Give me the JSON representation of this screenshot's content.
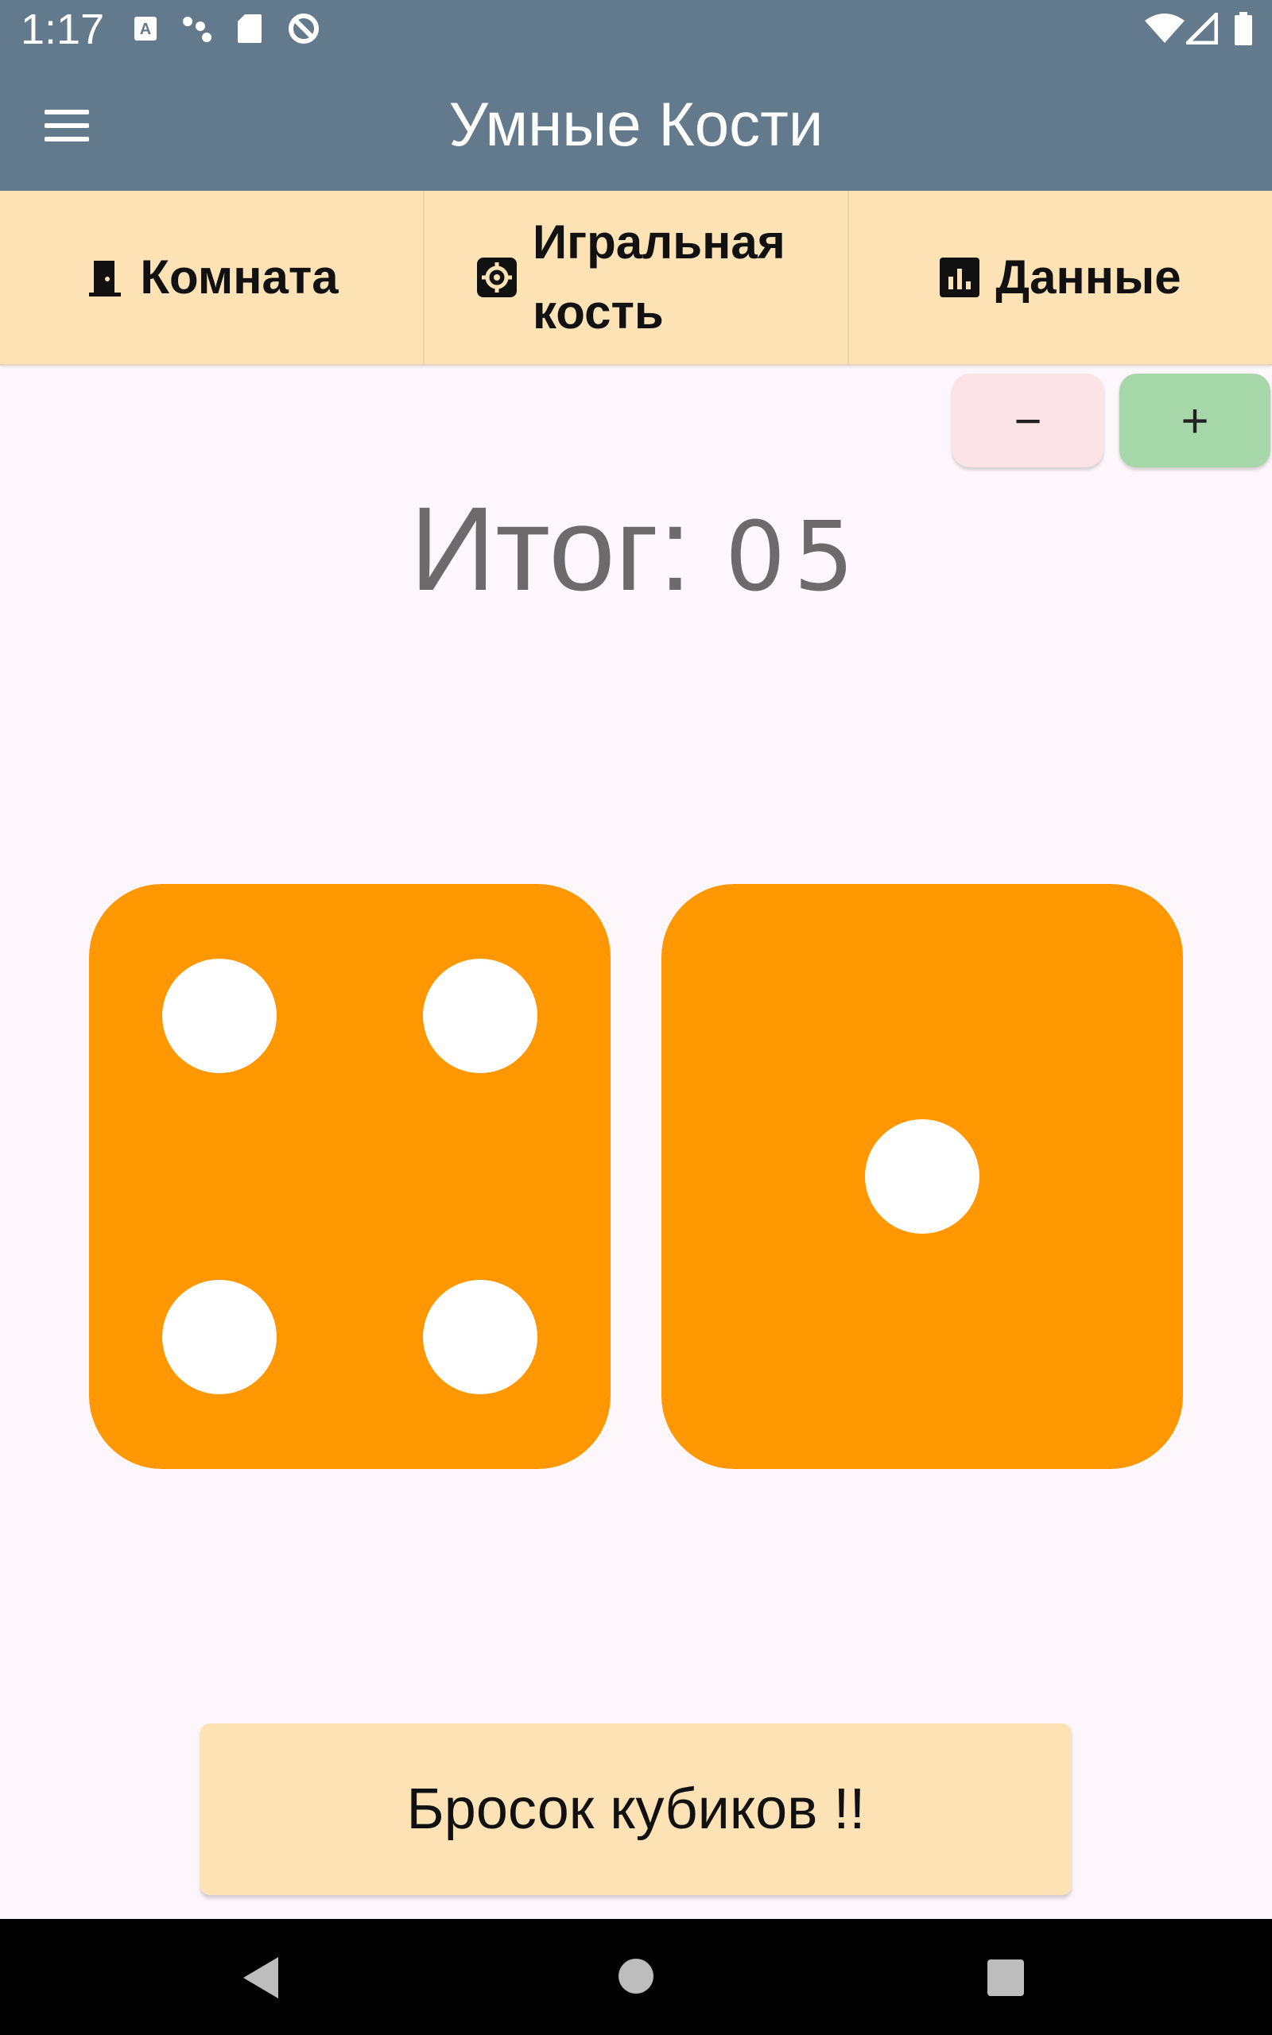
{
  "status_bar": {
    "time": "1:17",
    "left_icons": [
      "keyboard-a-icon",
      "dots-icon",
      "sd-card-icon",
      "sync-icon"
    ],
    "right_icons": [
      "wifi-icon",
      "signal-icon",
      "battery-icon"
    ]
  },
  "app_bar": {
    "title": "Умные Кости",
    "menu_icon": "menu-icon"
  },
  "tabs": [
    {
      "label": "Комната",
      "icon": "door-icon"
    },
    {
      "label": "Игральная кость",
      "icon": "gear-icon"
    },
    {
      "label": "Данные",
      "icon": "bar-chart-icon"
    }
  ],
  "stepper": {
    "minus_label": "−",
    "plus_label": "+"
  },
  "total": {
    "label": "Итог:",
    "value": "05"
  },
  "dice": [
    {
      "value": 4
    },
    {
      "value": 1
    }
  ],
  "roll_button": {
    "label": "Бросок кубиков !!"
  },
  "colors": {
    "app_bar": "#627a8c",
    "tab_bg": "#fde2b5",
    "die": "#ff9800",
    "minus_btn": "#fbe3e8",
    "plus_btn": "#a6d7a8",
    "background": "#fdf7fb"
  },
  "nav_bar": {
    "icons": [
      "back-icon",
      "home-icon",
      "recents-icon"
    ]
  }
}
